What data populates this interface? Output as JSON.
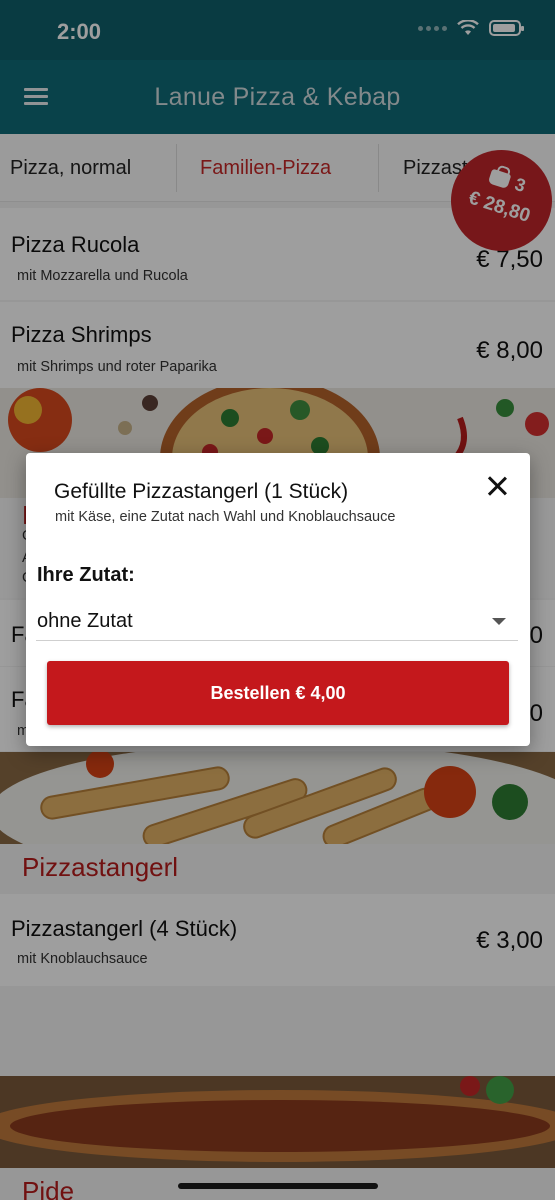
{
  "status": {
    "time": "2:00"
  },
  "app": {
    "title": "Lanue Pizza & Kebap"
  },
  "tabs": [
    {
      "label": "Pizza, normal"
    },
    {
      "label": "Familien-Pizza"
    },
    {
      "label": "Pizzastangerl"
    }
  ],
  "basket": {
    "count": "3",
    "total": "€ 28,80"
  },
  "items": [
    {
      "name": "Pizza Rucola",
      "desc": "mit Mozzarella und Rucola",
      "price": "€ 7,50"
    },
    {
      "name": "Pizza Shrimps",
      "desc": "mit Shrimps und roter Paparika",
      "price": "€ 8,00"
    },
    {
      "name": "Pizzastangerl (4 Stück)",
      "desc": "mit Knoblauchsauce",
      "price": "€ 3,00"
    }
  ],
  "hidden_rows": [
    {
      "name_fragment": "Fa",
      "price_fragment": "0"
    },
    {
      "name_fragment": "Fa",
      "desc_fragment": "m",
      "price_fragment": "0"
    }
  ],
  "hidden_section_fragment": {
    "title": "F",
    "lines": [
      "G",
      "A",
      "G"
    ]
  },
  "sections": [
    {
      "title": "Pizzastangerl"
    },
    {
      "title": "Pide"
    }
  ],
  "dialog": {
    "title": "Gefüllte Pizzastangerl (1 Stück)",
    "subtitle": "mit Käse, eine Zutat nach Wahl und Knoblauchsauce",
    "option_label": "Ihre Zutat:",
    "option_value": "ohne Zutat",
    "order_button": "Bestellen € 4,00"
  },
  "colors": {
    "app_bar": "#0f6b78",
    "accent": "#c62828",
    "button": "#c4181c"
  }
}
